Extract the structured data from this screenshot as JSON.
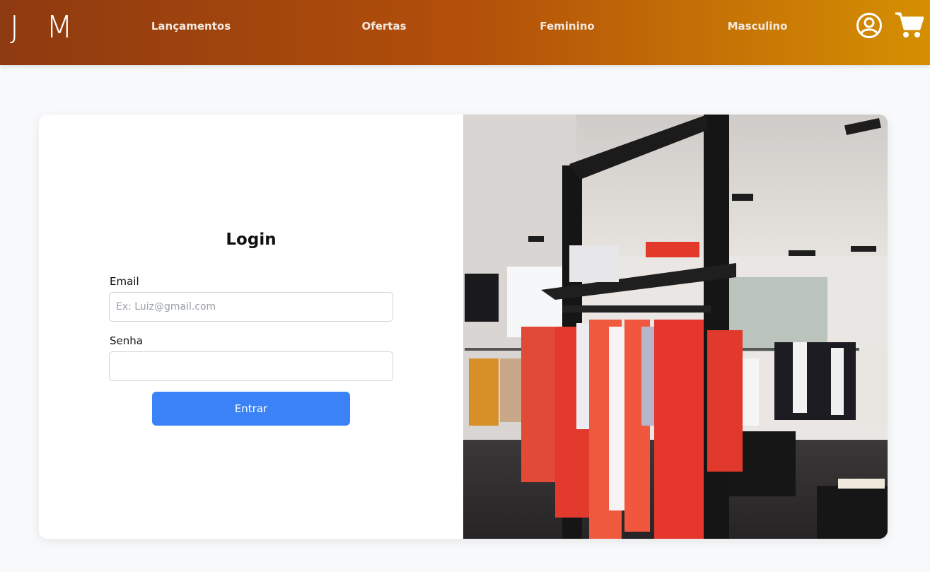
{
  "header": {
    "logo": "J M",
    "nav": [
      {
        "label": "Lançamentos"
      },
      {
        "label": "Ofertas"
      },
      {
        "label": "Feminino"
      },
      {
        "label": "Masculino"
      }
    ],
    "icons": [
      "user-circle-icon",
      "shopping-cart-icon"
    ]
  },
  "login": {
    "title": "Login",
    "email_label": "Email",
    "email_placeholder": "Ex: Luiz@gmail.com",
    "email_value": "",
    "password_label": "Senha",
    "password_value": "",
    "submit_label": "Entrar"
  },
  "colors": {
    "header_gradient_start": "#8e3a10",
    "header_gradient_end": "#d58f02",
    "button": "#3b82f6",
    "page_background": "#f8f9fb"
  }
}
